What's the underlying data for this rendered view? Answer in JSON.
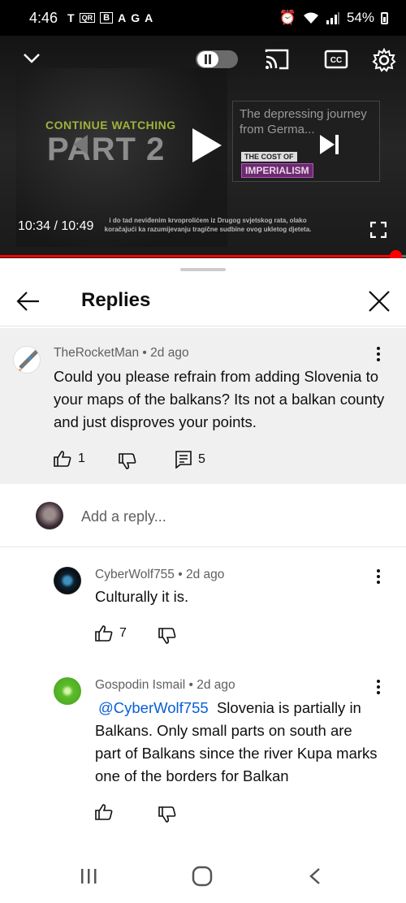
{
  "status_bar": {
    "time": "4:46",
    "battery": "54%",
    "left_icons": [
      "T",
      "QR",
      "B",
      "A",
      "G",
      "A"
    ]
  },
  "player": {
    "overlay_continue": "CONTINUE WATCHING",
    "overlay_part": "PART 2",
    "next_title": "The depressing journey from Germa...",
    "next_tag_top": "THE COST OF",
    "next_tag_bottom": "IMPERIALISM",
    "time": "10:34 / 10:49",
    "subtitle": "i do tad neviđenim krvoprolićem iz Drugog svjetskog rata, olako koračajući ka razumijevanju tragične sudbine ovog ukletog djeteta.",
    "progress_fraction": 0.974,
    "colors": {
      "progress": "#ff0000"
    }
  },
  "sheet": {
    "title": "Replies"
  },
  "parent_comment": {
    "author": "TheRocketMan",
    "age": "2d ago",
    "text": "Could you please refrain from adding Slovenia to your maps of the balkans? Its not a balkan county and just disproves your points.",
    "likes": "1",
    "replies": "5"
  },
  "reply_box": {
    "placeholder": "Add a reply..."
  },
  "replies": [
    {
      "author": "CyberWolf755",
      "age": "2d ago",
      "text": "Culturally it is.",
      "likes": "7"
    },
    {
      "author": "Gospodin Ismail",
      "age": "2d ago",
      "mention": "@CyberWolf755",
      "text": "Slovenia is partially in Balkans. Only small parts on south are part of Balkans since the river Kupa marks one of the borders for Balkan"
    }
  ],
  "meta_separator": "•"
}
